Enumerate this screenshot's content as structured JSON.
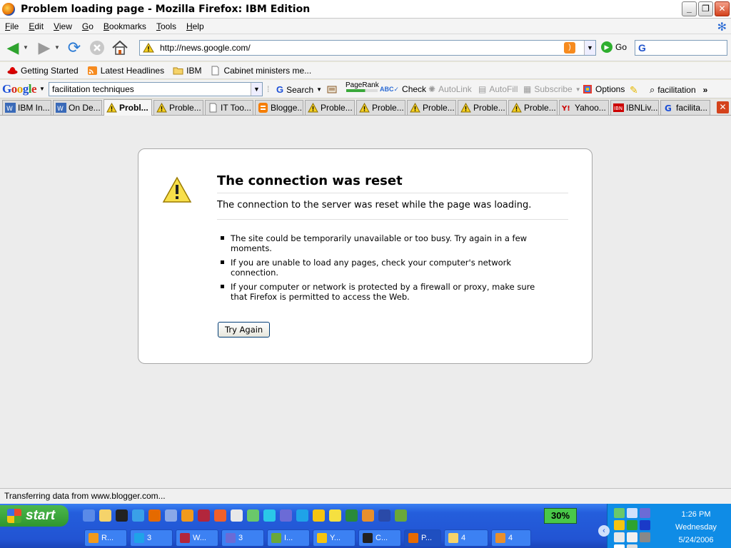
{
  "window": {
    "title": "Problem loading page - Mozilla Firefox: IBM Edition"
  },
  "menu": {
    "items": [
      "File",
      "Edit",
      "View",
      "Go",
      "Bookmarks",
      "Tools",
      "Help"
    ]
  },
  "nav": {
    "url": "http://news.google.com/",
    "go_label": "Go"
  },
  "bookmarks": {
    "items": [
      "Getting Started",
      "Latest Headlines",
      "IBM",
      "Cabinet ministers me..."
    ]
  },
  "google_toolbar": {
    "logo": "Google",
    "query": "facilitation techniques",
    "search_label": "Search",
    "pagerank_label": "PageRank",
    "check_label": "Check",
    "autolink_label": "AutoLink",
    "autofill_label": "AutoFill",
    "subscribe_label": "Subscribe",
    "options_label": "Options",
    "highlight_term": "facilitation",
    "more": "»"
  },
  "tabs": [
    {
      "label": "IBM In...",
      "icon": "ibm-w-icon"
    },
    {
      "label": "On De...",
      "icon": "ibm-w-icon"
    },
    {
      "label": "Probl...",
      "icon": "warning-icon",
      "active": true
    },
    {
      "label": "Proble...",
      "icon": "warning-icon"
    },
    {
      "label": "IT Too...",
      "icon": "page-icon"
    },
    {
      "label": "Blogge...",
      "icon": "blogger-icon"
    },
    {
      "label": "Proble...",
      "icon": "warning-icon"
    },
    {
      "label": "Proble...",
      "icon": "warning-icon"
    },
    {
      "label": "Proble...",
      "icon": "warning-icon"
    },
    {
      "label": "Proble...",
      "icon": "warning-icon"
    },
    {
      "label": "Proble...",
      "icon": "warning-icon"
    },
    {
      "label": "Yahoo...",
      "icon": "yahoo-icon"
    },
    {
      "label": "IBNLiv...",
      "icon": "ibn-icon"
    },
    {
      "label": "facilita...",
      "icon": "google-icon"
    }
  ],
  "error": {
    "title": "The connection was reset",
    "lead": "The connection to the server was reset while the page was loading.",
    "bullets": [
      "The site could be temporarily unavailable or too busy. Try again in a few moments.",
      "If you are unable to load any pages, check your computer's network connection.",
      "If your computer or network is protected by a firewall or proxy, make sure that Firefox is permitted to access the Web."
    ],
    "button": "Try Again"
  },
  "status": {
    "text": "Transferring data from www.blogger.com..."
  },
  "taskbar": {
    "start_label": "start",
    "cpu": "30%",
    "time": "1:26 PM",
    "day": "Wednesday",
    "date": "5/24/2006",
    "buttons": [
      {
        "label": "R...",
        "color": "#f19a1c"
      },
      {
        "label": "3 ",
        "color": "#1fa3e8"
      },
      {
        "label": "W...",
        "color": "#b2263c"
      },
      {
        "label": "3 ",
        "color": "#6b6bd6"
      },
      {
        "label": "I...",
        "color": "#6aa83a"
      },
      {
        "label": "Y...",
        "color": "#f5c410"
      },
      {
        "label": "C...",
        "color": "#222222"
      },
      {
        "label": "P...",
        "color": "#e56a00",
        "active": true
      },
      {
        "label": "4 ",
        "color": "#f5d36a"
      },
      {
        "label": "4 ",
        "color": "#e88f2c"
      }
    ]
  },
  "colors": {
    "taskbar": "#245edc",
    "start": "#2f962f",
    "tray": "#0f8ce6"
  }
}
